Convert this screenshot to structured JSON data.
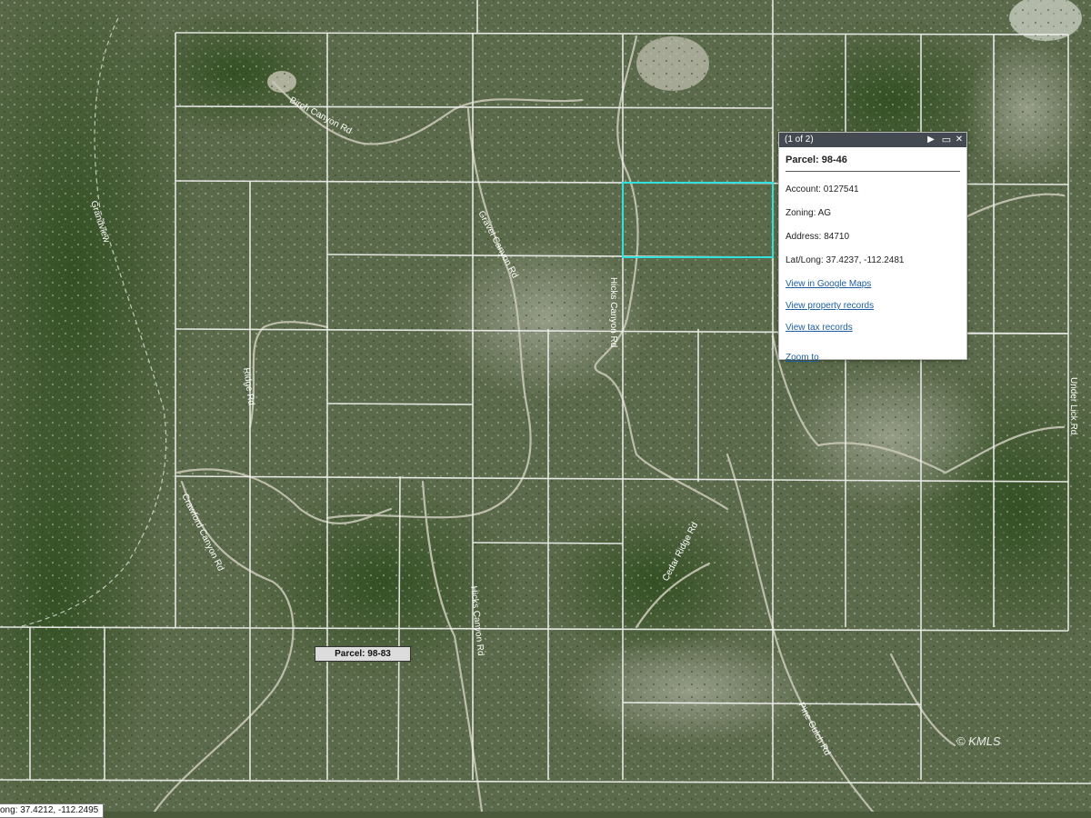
{
  "popup": {
    "counter": "(1 of 2)",
    "title": "Parcel: 98-46",
    "account": "Account: 0127541",
    "zoning": "Zoning: AG",
    "address": "Address: 84710",
    "latlong": "Lat/Long: 37.4237, -112.2481",
    "links": {
      "google_maps": "View in Google Maps",
      "property_records": "View property records",
      "tax_records": "View tax records",
      "zoom_to": "Zoom to"
    },
    "controls": {
      "next": "▶",
      "maximize": "▭",
      "close": "✕"
    }
  },
  "hover_label": "Parcel: 98-83",
  "coordinate_readout": "ong: 37.4212, -112.2495",
  "watermark": "© KMLS",
  "road_labels": {
    "birch_canyon": "Birch Canyon Rd",
    "grandview": "Grandview",
    "gravel_canyon": "Gravel Canyon Rd",
    "hicks_1": "Hicks Canyon Rd",
    "ridge_rd": "Ridge Rd",
    "crawford": "Crawford Canyon Rd",
    "hicks_2": "Hicks Canyon Rd",
    "cedar_ridge": "Cedar Ridge Rd",
    "pine_gulch": "Pine Gulch Rd",
    "under_lick": "Under Lick Rd"
  },
  "colors": {
    "parcel_lines": "#f2f2f2",
    "selected_parcel": "#33e0e0",
    "popup_header": "#444a52",
    "link": "#1d5fa0"
  }
}
